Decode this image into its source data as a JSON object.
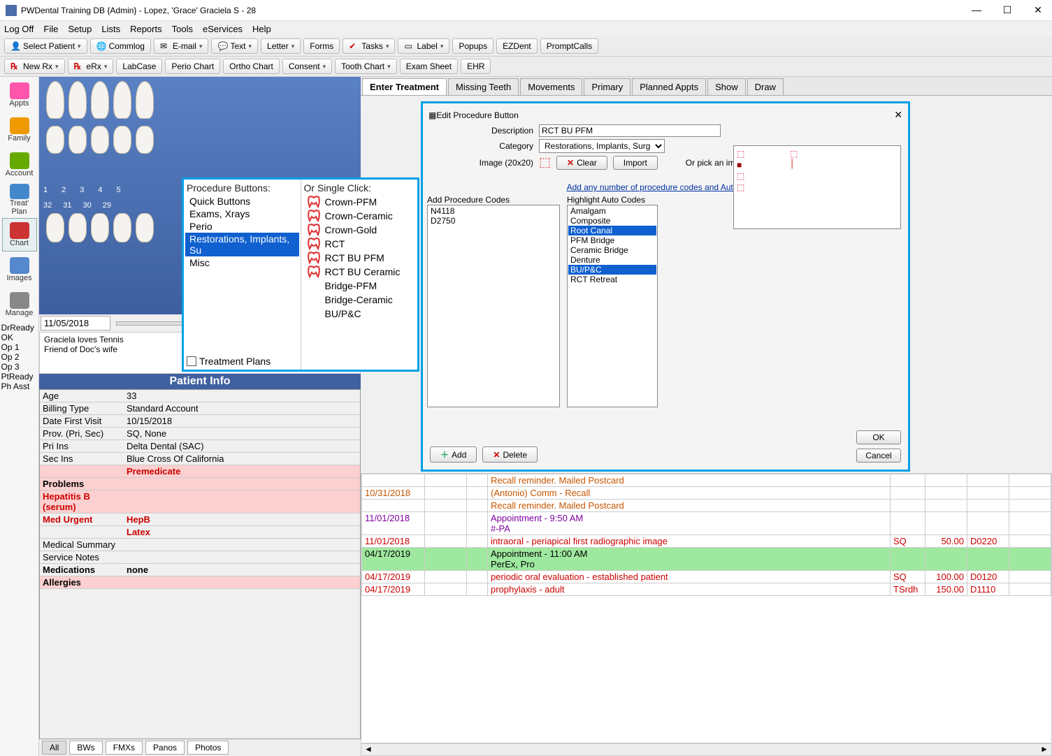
{
  "window": {
    "title": "PWDental Training DB {Admin} - Lopez, 'Grace' Graciela S - 28"
  },
  "menubar": [
    "Log Off",
    "File",
    "Setup",
    "Lists",
    "Reports",
    "Tools",
    "eServices",
    "Help"
  ],
  "toolbar_row1": {
    "select_patient": "Select Patient",
    "commlog": "Commlog",
    "email": "E-mail",
    "text": "Text",
    "letter": "Letter",
    "forms": "Forms",
    "tasks": "Tasks",
    "label": "Label",
    "popups": "Popups",
    "ezdent": "EZDent",
    "promptcalls": "PromptCalls"
  },
  "toolbar_row2": {
    "newrx": "New Rx",
    "erx": "eRx",
    "labcase": "LabCase",
    "periochart": "Perio Chart",
    "orthochart": "Ortho Chart",
    "consent": "Consent",
    "toothchart": "Tooth Chart",
    "examsheet": "Exam Sheet",
    "ehr": "EHR"
  },
  "sidenav": [
    "Appts",
    "Family",
    "Account",
    "Treat' Plan",
    "Chart",
    "Images",
    "Manage"
  ],
  "sidesec": [
    "DrReady",
    "OK",
    "Op 1",
    "Op 2",
    "Op 3",
    "PtReady",
    "Ph Asst"
  ],
  "date_note": "11/05/2018",
  "notes": [
    "Graciela loves Tennis",
    "Friend of Doc's wife"
  ],
  "patinfo_header": "Patient Info",
  "patinfo": [
    {
      "k": "Age",
      "v": "33"
    },
    {
      "k": "Billing Type",
      "v": "Standard Account"
    },
    {
      "k": "Date First Visit",
      "v": "10/15/2018"
    },
    {
      "k": "Prov. (Pri, Sec)",
      "v": "SQ, None"
    },
    {
      "k": "Pri Ins",
      "v": "Delta Dental (SAC)"
    },
    {
      "k": "Sec Ins",
      "v": "Blue Cross Of California"
    },
    {
      "k": "",
      "v": "Premedicate",
      "cls": "pink red"
    },
    {
      "k": "Problems",
      "v": "",
      "cls": "pink b"
    },
    {
      "k": "Hepatitis B (serum)",
      "v": "",
      "cls": "pink red"
    },
    {
      "k": "Med Urgent",
      "v": "HepB",
      "cls": "red"
    },
    {
      "k": "",
      "v": "Latex",
      "cls": "red"
    },
    {
      "k": "Medical Summary",
      "v": ""
    },
    {
      "k": "Service Notes",
      "v": ""
    },
    {
      "k": "Medications",
      "v": "none",
      "cls": "b"
    },
    {
      "k": "Allergies",
      "v": "",
      "cls": "pink b"
    }
  ],
  "bottomtabs": [
    "All",
    "BWs",
    "FMXs",
    "Panos",
    "Photos"
  ],
  "righttabs": [
    "Enter Treatment",
    "Missing Teeth",
    "Movements",
    "Primary",
    "Planned Appts",
    "Show",
    "Draw"
  ],
  "procpop": {
    "hdr1": "Procedure Buttons:",
    "hdr2": "Or Single Click:",
    "cats": [
      "Quick Buttons",
      "Exams, Xrays",
      "Perio",
      "Restorations, Implants, Su",
      "Misc"
    ],
    "sel_cat": 3,
    "tp": "Treatment Plans",
    "items": [
      "Crown-PFM",
      "Crown-Ceramic",
      "Crown-Gold",
      "RCT",
      "RCT BU PFM",
      "RCT BU Ceramic",
      "Bridge-PFM",
      "Bridge-Ceramic",
      "BU/P&C"
    ]
  },
  "editdlg": {
    "title": "Edit Procedure Button",
    "desc_lbl": "Description",
    "desc_val": "RCT BU PFM",
    "cat_lbl": "Category",
    "cat_val": "Restorations, Implants, Surgery",
    "img_lbl": "Image (20x20)",
    "clear": "Clear",
    "import": "Import",
    "orpick": "Or pick an image from this list",
    "addlink": "Add any number of procedure codes and Auto Codes",
    "addhdr": "Add Procedure Codes",
    "codes": [
      "N4118",
      "D2750"
    ],
    "autohdr": "Highlight Auto Codes",
    "autos": [
      "Amalgam",
      "Composite",
      "Root Canal",
      "PFM Bridge",
      "Ceramic Bridge",
      "Denture",
      "BU/P&C",
      "RCT Retreat"
    ],
    "auto_sel": [
      2,
      6
    ],
    "add": "Add",
    "delete": "Delete",
    "ok": "OK",
    "cancel": "Cancel"
  },
  "chartlog": [
    {
      "d": "",
      "desc": "Recall reminder.  Mailed Postcard",
      "cls": "orange"
    },
    {
      "d": "10/31/2018",
      "desc": "(Antonio) Comm - Recall",
      "cls": "orange"
    },
    {
      "d": "",
      "desc": "Recall reminder.  Mailed Postcard",
      "cls": "orange"
    },
    {
      "d": "11/01/2018",
      "desc": "Appointment - 9:50 AM\n#-PA",
      "cls": "purple"
    },
    {
      "d": "11/01/2018",
      "desc": "intraoral - periapical first radiographic image",
      "p": "SQ",
      "a": "50.00",
      "c": "D0220",
      "cls": "redt"
    },
    {
      "d": "04/17/2019",
      "desc": "Appointment - 11:00 AM\nPerEx, Pro",
      "cls": "green"
    },
    {
      "d": "04/17/2019",
      "desc": "periodic oral evaluation - established patient",
      "p": "SQ",
      "a": "100.00",
      "c": "D0120",
      "cls": "redt"
    },
    {
      "d": "04/17/2019",
      "desc": "prophylaxis - adult",
      "p": "TSrdh",
      "a": "150.00",
      "c": "D1110",
      "cls": "redt"
    }
  ]
}
